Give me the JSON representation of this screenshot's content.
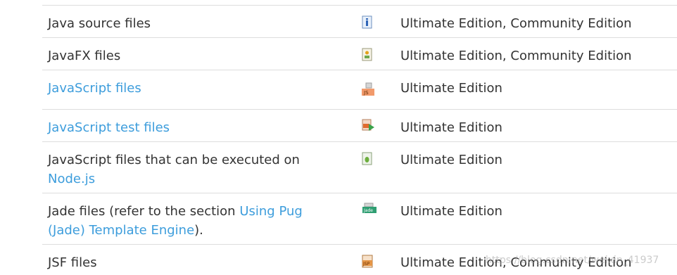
{
  "rows": [
    {
      "name": "Java source files",
      "icon": "java-file-icon",
      "editions": "Ultimate Edition, Community Edition"
    },
    {
      "name": "JavaFX files",
      "icon": "javafx-file-icon",
      "editions": "Ultimate Edition, Community Edition"
    },
    {
      "name_link": "JavaScript files",
      "icon": "javascript-file-icon",
      "editions": "Ultimate Edition"
    },
    {
      "name_link": "JavaScript test files",
      "icon": "javascript-test-file-icon",
      "editions": "Ultimate Edition"
    },
    {
      "name_text": "JavaScript files that can be executed on",
      "name_link": "Node.js",
      "icon": "nodejs-file-icon",
      "editions": "Ultimate Edition"
    },
    {
      "name_prefix": "Jade files (refer to the section",
      "name_link": "Using Pug (Jade) Template Engine",
      "name_suffix": ").",
      "icon": "jade-file-icon",
      "editions": "Ultimate Edition"
    },
    {
      "name": "JSF files",
      "icon": "jsf-file-icon",
      "editions": "Ultimate Edition, Community Edition"
    }
  ],
  "watermark": "https://blog.csdn.net/weixin_41937",
  "colors": {
    "link": "#3d9ddc",
    "text": "#333333",
    "divider": "#dddddd"
  }
}
